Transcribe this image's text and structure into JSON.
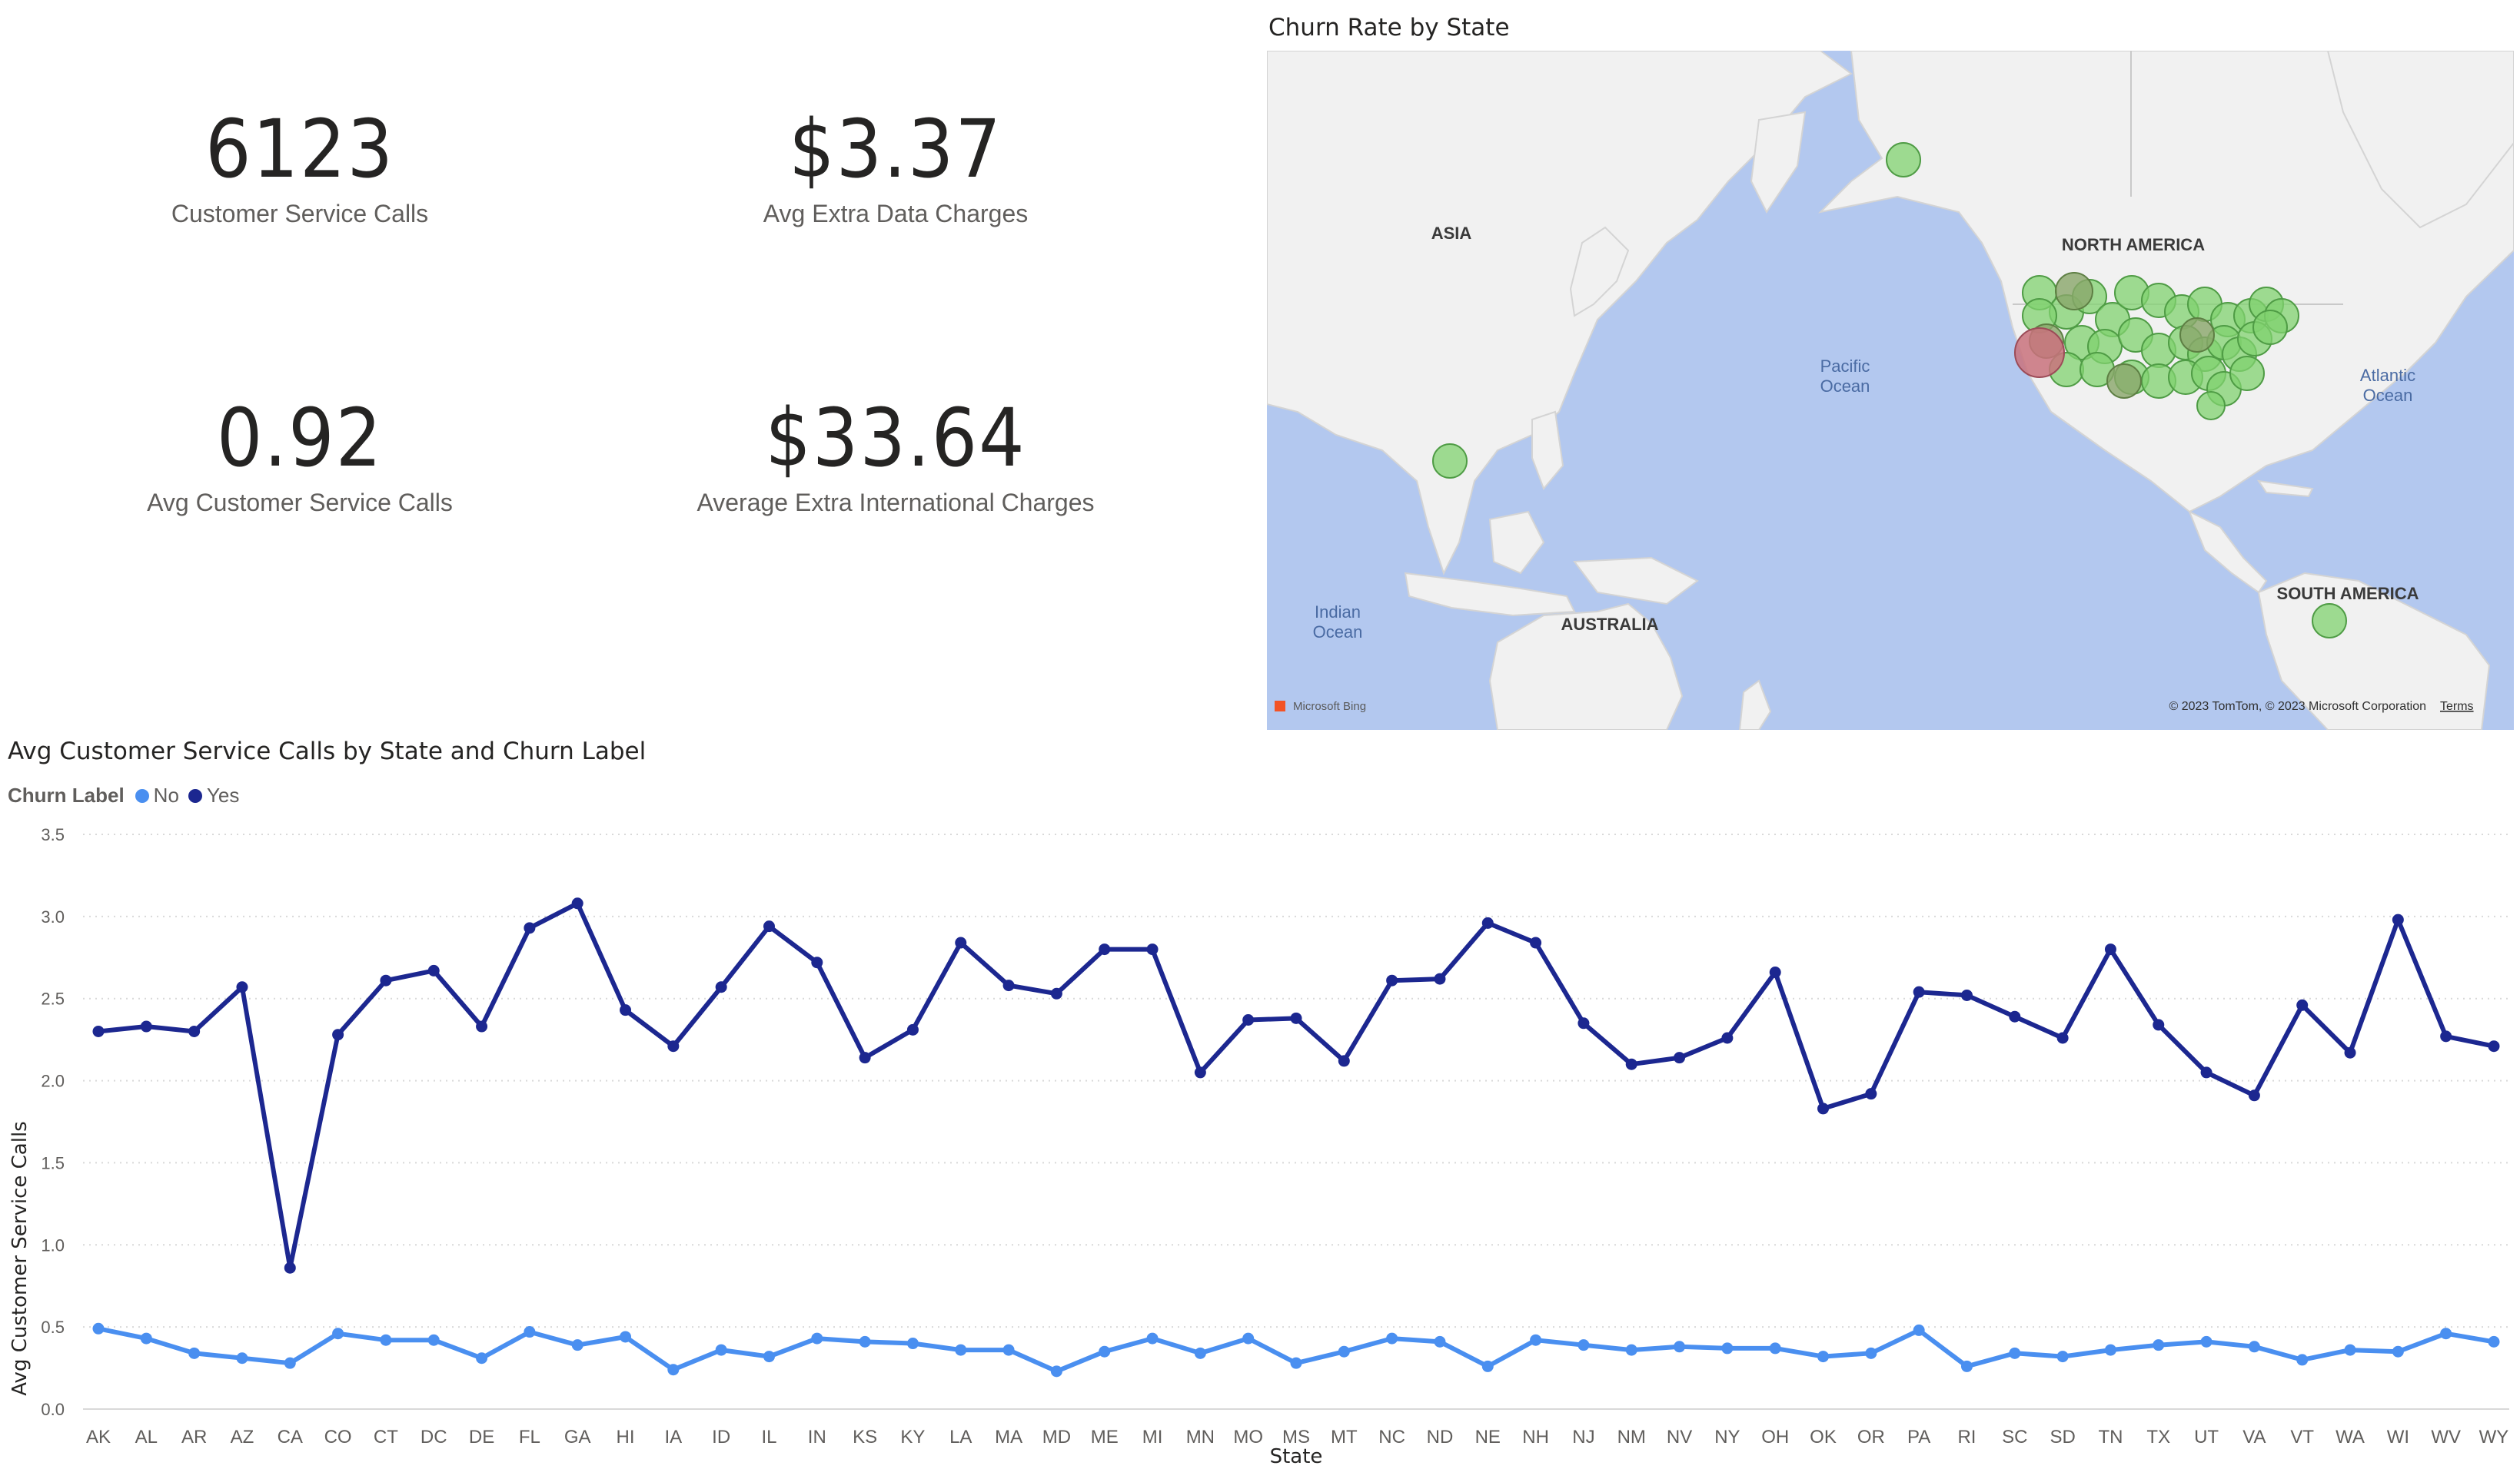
{
  "kpis": [
    {
      "value": "6123",
      "label": "Customer Service Calls"
    },
    {
      "value": "$3.37",
      "label": "Avg Extra Data Charges"
    },
    {
      "value": "0.92",
      "label": "Avg Customer Service Calls"
    },
    {
      "value": "$33.64",
      "label": "Average Extra International Charges"
    }
  ],
  "map": {
    "title": "Churn Rate by State",
    "labels": {
      "asia": "ASIA",
      "north_america": "NORTH AMERICA",
      "south_america": "SOUTH AMERICA",
      "australia": "AUSTRALIA",
      "pacific_1": "Pacific",
      "pacific_2": "Ocean",
      "atlantic_1": "Atlantic",
      "atlantic_2": "Ocean",
      "indian_1": "Indian",
      "indian_2": "Ocean"
    },
    "attribution": "© 2023 TomTom, © 2023 Microsoft Corporation",
    "terms": "Terms",
    "logo_text": "Microsoft Bing",
    "colors": {
      "water": "#b3c8ef",
      "land": "#f2f2f2",
      "bubble_low": "#7fd06e",
      "bubble_high": "#c9727d"
    }
  },
  "chart_data": {
    "type": "line",
    "title": "Avg Customer Service Calls by State and Churn Label",
    "legend_title": "Churn Label",
    "xlabel": "State",
    "ylabel": "Avg Customer Service Calls",
    "ylim": [
      0,
      3.5
    ],
    "yticks": [
      "0.0",
      "0.5",
      "1.0",
      "1.5",
      "2.0",
      "2.5",
      "3.0",
      "3.5"
    ],
    "grid": true,
    "legend_position": "top-left",
    "categories": [
      "AK",
      "AL",
      "AR",
      "AZ",
      "CA",
      "CO",
      "CT",
      "DC",
      "DE",
      "FL",
      "GA",
      "HI",
      "IA",
      "ID",
      "IL",
      "IN",
      "KS",
      "KY",
      "LA",
      "MA",
      "MD",
      "ME",
      "MI",
      "MN",
      "MO",
      "MS",
      "MT",
      "NC",
      "ND",
      "NE",
      "NH",
      "NJ",
      "NM",
      "NV",
      "NY",
      "OH",
      "OK",
      "OR",
      "PA",
      "RI",
      "SC",
      "SD",
      "TN",
      "TX",
      "UT",
      "VA",
      "VT",
      "WA",
      "WI",
      "WV",
      "WY"
    ],
    "series": [
      {
        "name": "No",
        "color": "#4a8ff0",
        "values": [
          0.49,
          0.43,
          0.34,
          0.31,
          0.28,
          0.46,
          0.42,
          0.42,
          0.31,
          0.47,
          0.39,
          0.44,
          0.24,
          0.36,
          0.32,
          0.43,
          0.41,
          0.4,
          0.36,
          0.36,
          0.23,
          0.35,
          0.43,
          0.34,
          0.43,
          0.28,
          0.35,
          0.43,
          0.41,
          0.26,
          0.42,
          0.39,
          0.36,
          0.38,
          0.37,
          0.37,
          0.32,
          0.34,
          0.48,
          0.26,
          0.34,
          0.32,
          0.36,
          0.39,
          0.41,
          0.38,
          0.3,
          0.36,
          0.35,
          0.46,
          0.41
        ]
      },
      {
        "name": "Yes",
        "color": "#1c2790",
        "values": [
          2.3,
          2.33,
          2.3,
          2.57,
          0.86,
          2.28,
          2.61,
          2.67,
          2.33,
          2.93,
          3.08,
          2.43,
          2.21,
          2.57,
          2.94,
          2.72,
          2.14,
          2.31,
          2.84,
          2.58,
          2.53,
          2.8,
          2.8,
          2.05,
          2.37,
          2.38,
          2.12,
          2.61,
          2.62,
          2.96,
          2.84,
          2.35,
          2.1,
          2.14,
          2.26,
          2.66,
          1.83,
          1.92,
          2.54,
          2.52,
          2.39,
          2.26,
          2.8,
          2.34,
          2.05,
          1.91,
          2.46,
          2.17,
          2.98,
          2.27,
          2.21
        ]
      }
    ]
  }
}
